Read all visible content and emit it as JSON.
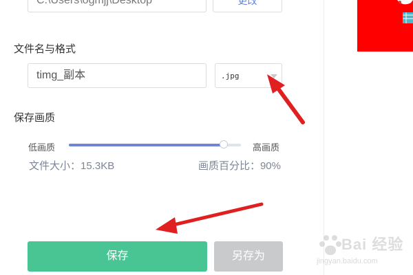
{
  "export_panel": {
    "save_path": "C:\\Users\\ogmjj\\Desktop",
    "change_label": "更改",
    "filename_section_label": "文件名与格式",
    "filename_value": "timg_副本",
    "format_value": ".jpg",
    "quality_section_label": "保存画质",
    "quality_low_label": "低画质",
    "quality_high_label": "高画质",
    "quality_level_percent": 90,
    "file_size_text": "文件大小：15.3KB",
    "quality_percent_text": "画质百分比：90%",
    "save_label": "保存",
    "save_as_label": "另存为"
  },
  "colors": {
    "save_button": "#49c594",
    "save_as_button_disabled": "#c9cacc",
    "slider_fill": "#6f86d6",
    "annotation_arrow": "#e02020",
    "preview_background": "#ff0000"
  },
  "watermark": {
    "brand": "Bai 经验",
    "url": "jingyan.baidu.com"
  }
}
